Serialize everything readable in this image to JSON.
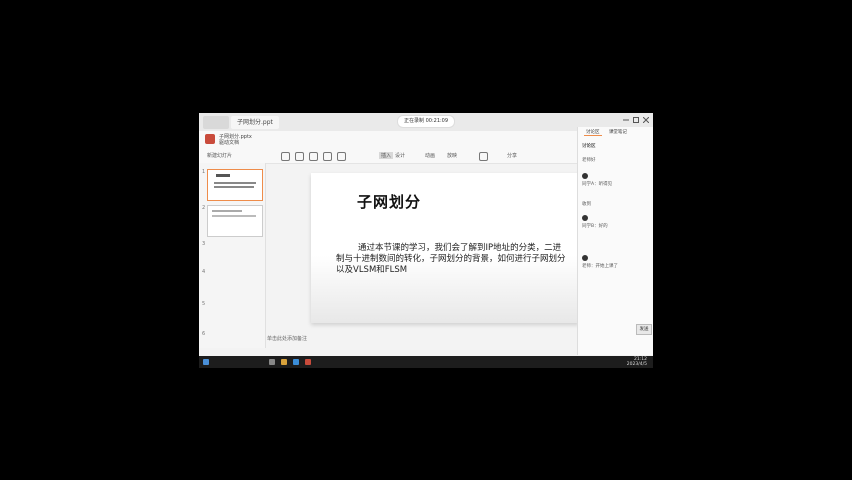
{
  "window": {
    "doc_tab_label": "子网划分.ppt",
    "recording_label": "正在录制 00:21:09",
    "file_name": "子网划分.pptx",
    "file_sub": "驱动文档"
  },
  "toolbar": {
    "new_slide_label": "新建幻灯片",
    "insert_label": "插入",
    "design_label": "设计",
    "animation_label": "动画",
    "view_label": "放映",
    "share_label": "分享"
  },
  "sidebar": {
    "slide_numbers": [
      "1",
      "2",
      "3",
      "4",
      "5",
      "6"
    ]
  },
  "slide": {
    "title": "子网划分",
    "body": "通过本节课的学习，我们会了解到IP地址的分类，二进制与十进制数间的转化，子网划分的背景，如何进行子网划分以及VLSM和FLSM"
  },
  "notes": {
    "placeholder": "单击此处添加备注"
  },
  "chat": {
    "tabs": [
      "讨论区",
      "课堂笔记"
    ],
    "header": "讨论区",
    "messages": [
      "老师好",
      "同学A：听得见",
      "收到",
      "同学B：好的",
      "老师：开始上课了"
    ],
    "send_label": "发送"
  },
  "taskbar": {
    "time": "21:12",
    "date": "2023/4/5"
  },
  "colors": {
    "accent": "#ee8c4a",
    "logo": "#c94b3b",
    "background": "#000000"
  }
}
